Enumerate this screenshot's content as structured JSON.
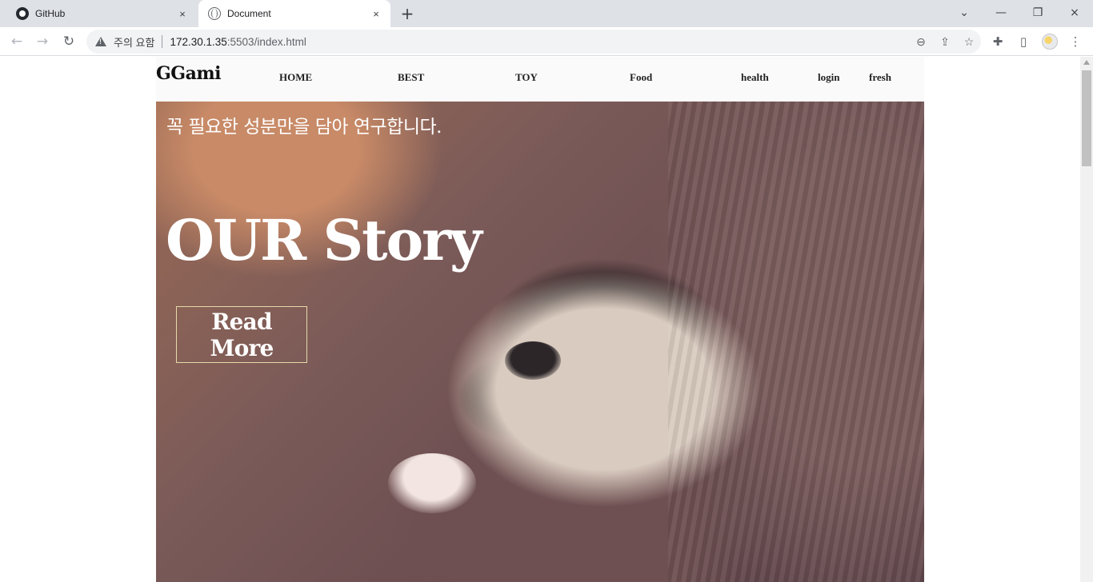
{
  "browser": {
    "tabs": [
      {
        "title": "GitHub",
        "active": false,
        "favicon": "github-icon"
      },
      {
        "title": "Document",
        "active": true,
        "favicon": "globe-icon"
      }
    ],
    "address": {
      "security_label": "주의 요함",
      "host": "172.30.1.35",
      "rest": ":5503/index.html"
    },
    "icons": {
      "close": "×",
      "new_tab": "+",
      "back": "←",
      "forward": "→",
      "reload": "↻",
      "zoom": "⊖",
      "share": "⇪",
      "star": "☆",
      "extensions": "✚",
      "sidepanel": "▯",
      "menu": "⋮",
      "dropdown": "⌄",
      "minimize": "—",
      "restore": "❐"
    }
  },
  "site": {
    "logo": "GGami",
    "nav": [
      "HOME",
      "BEST",
      "TOY",
      "Food",
      "health",
      "login",
      "fresh"
    ],
    "hero": {
      "subtitle": "꼭 필요한 성분만을 담아 연구합니다.",
      "title": "OUR Story",
      "button": "Read More"
    }
  }
}
